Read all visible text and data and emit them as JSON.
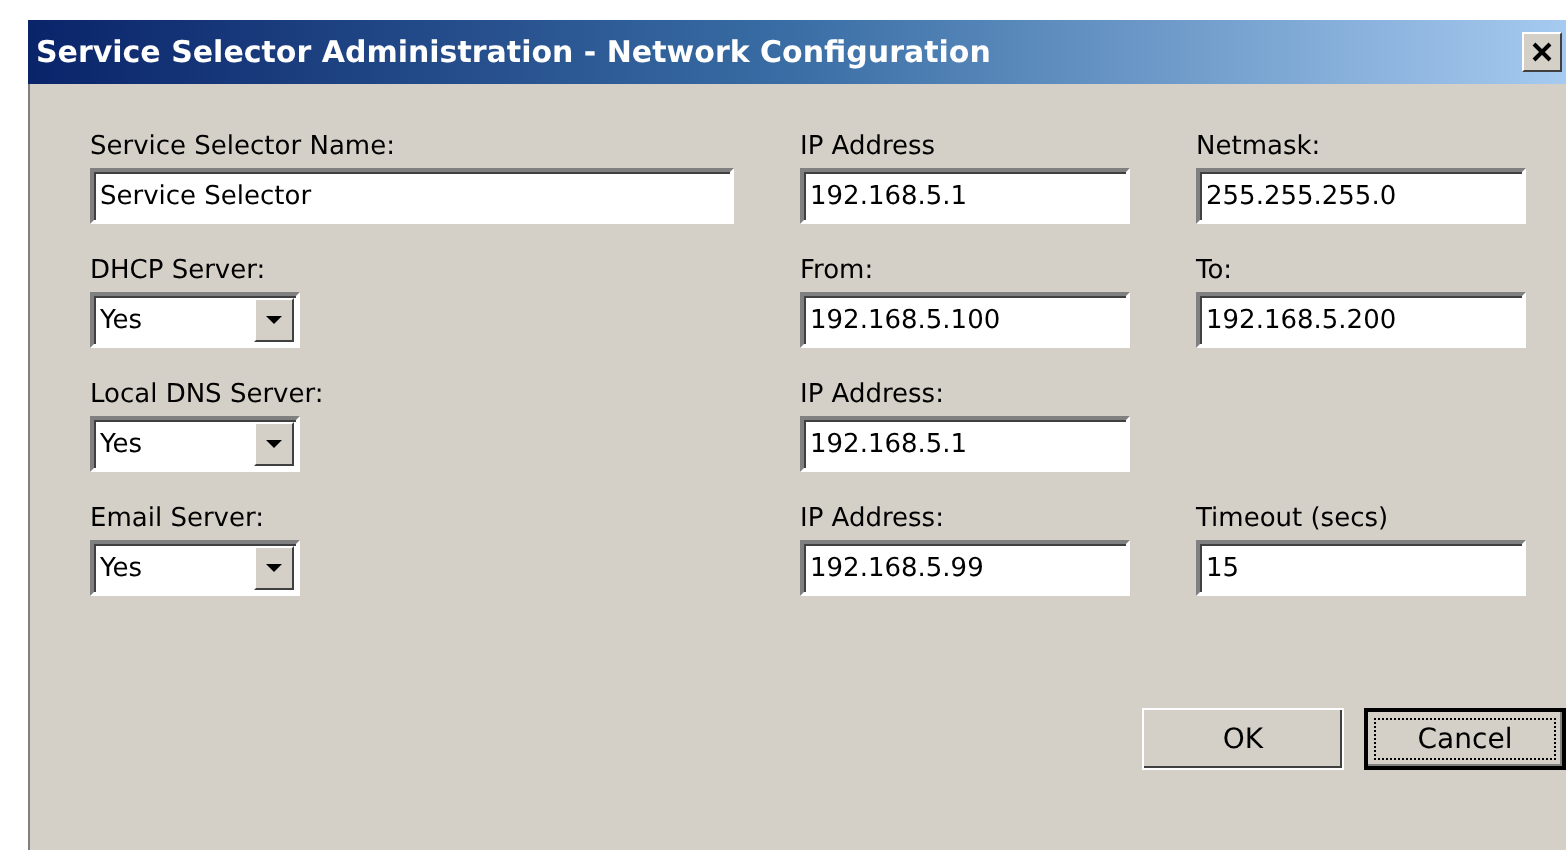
{
  "window": {
    "title": "Service Selector Administration - Network Configuration"
  },
  "rows": [
    {
      "fields": [
        {
          "kind": "text",
          "label": "Service Selector Name:",
          "value": "Service Selector"
        },
        {
          "kind": "text",
          "label": "IP Address",
          "value": "192.168.5.1"
        },
        {
          "kind": "text",
          "label": "Netmask:",
          "value": "255.255.255.0"
        }
      ]
    },
    {
      "fields": [
        {
          "kind": "select",
          "label": "DHCP Server:",
          "value": "Yes"
        },
        {
          "kind": "text",
          "label": "From:",
          "value": "192.168.5.100"
        },
        {
          "kind": "text",
          "label": "To:",
          "value": "192.168.5.200"
        }
      ]
    },
    {
      "fields": [
        {
          "kind": "select",
          "label": "Local DNS Server:",
          "value": "Yes"
        },
        {
          "kind": "text",
          "label": "IP Address:",
          "value": "192.168.5.1"
        }
      ]
    },
    {
      "fields": [
        {
          "kind": "select",
          "label": "Email Server:",
          "value": "Yes"
        },
        {
          "kind": "text",
          "label": "IP Address:",
          "value": "192.168.5.99"
        },
        {
          "kind": "text",
          "label": "Timeout (secs)",
          "value": "15"
        }
      ]
    }
  ],
  "buttons": [
    {
      "label": "OK",
      "focused": false
    },
    {
      "label": "Cancel",
      "focused": true
    }
  ]
}
